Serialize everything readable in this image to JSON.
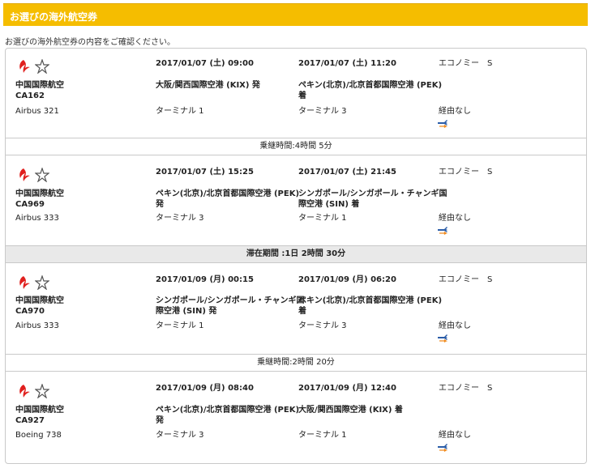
{
  "header": {
    "title": "お選びの海外航空券"
  },
  "subtitle": "お選びの海外航空券の内容をご確認ください。",
  "segments": [
    {
      "airline": "中国国際航空",
      "flight": "CA162",
      "aircraft": "Airbus 321",
      "dep_time": "2017/01/07 (土) 09:00",
      "arr_time": "2017/01/07 (土) 11:20",
      "dep_airport": "大阪/関西国際空港 (KIX) 発",
      "dep_airport_2": "",
      "arr_airport": "ペキン(北京)/北京首都国際空港 (PEK)",
      "arr_airport_2": "着",
      "dep_terminal": "ターミナル 1",
      "arr_terminal": "ターミナル 3",
      "cabin": "エコノミー　S",
      "stops": "経由なし"
    },
    {
      "airline": "中国国際航空",
      "flight": "CA969",
      "aircraft": "Airbus 333",
      "dep_time": "2017/01/07 (土) 15:25",
      "arr_time": "2017/01/07 (土) 21:45",
      "dep_airport": "ペキン(北京)/北京首都国際空港 (PEK)",
      "dep_airport_2": "発",
      "arr_airport": "シンガポール/シンガポール・チャンギ国",
      "arr_airport_2": "際空港 (SIN) 着",
      "dep_terminal": "ターミナル 3",
      "arr_terminal": "ターミナル 1",
      "cabin": "エコノミー　S",
      "stops": "経由なし"
    },
    {
      "airline": "中国国際航空",
      "flight": "CA970",
      "aircraft": "Airbus 333",
      "dep_time": "2017/01/09 (月) 00:15",
      "arr_time": "2017/01/09 (月) 06:20",
      "dep_airport": "シンガポール/シンガポール・チャンギ国",
      "dep_airport_2": "際空港 (SIN) 発",
      "arr_airport": "ペキン(北京)/北京首都国際空港 (PEK)",
      "arr_airport_2": "着",
      "dep_terminal": "ターミナル 1",
      "arr_terminal": "ターミナル 3",
      "cabin": "エコノミー　S",
      "stops": "経由なし"
    },
    {
      "airline": "中国国際航空",
      "flight": "CA927",
      "aircraft": "Boeing 738",
      "dep_time": "2017/01/09 (月) 08:40",
      "arr_time": "2017/01/09 (月) 12:40",
      "dep_airport": "ペキン(北京)/北京首都国際空港 (PEK)",
      "dep_airport_2": "発",
      "arr_airport": "大阪/関西国際空港 (KIX) 着",
      "arr_airport_2": "",
      "dep_terminal": "ターミナル 3",
      "arr_terminal": "ターミナル 1",
      "cabin": "エコノミー　S",
      "stops": "経由なし"
    }
  ],
  "separators": [
    {
      "text": "乗継時間:4時間 5分"
    },
    {
      "text": "滞在期間 :1日 2時間 30分"
    },
    {
      "text": "乗継時間:2時間 20分"
    }
  ],
  "icons": {
    "airline_logo": "air-china-logo-icon",
    "alliance_logo": "star-alliance-icon",
    "plane": "plane-transfer-icon"
  },
  "colors": {
    "header": "#f5bd00",
    "logo_red": "#e0201e",
    "plane_blue": "#2b5da8",
    "plane_orange": "#f08a1c"
  }
}
